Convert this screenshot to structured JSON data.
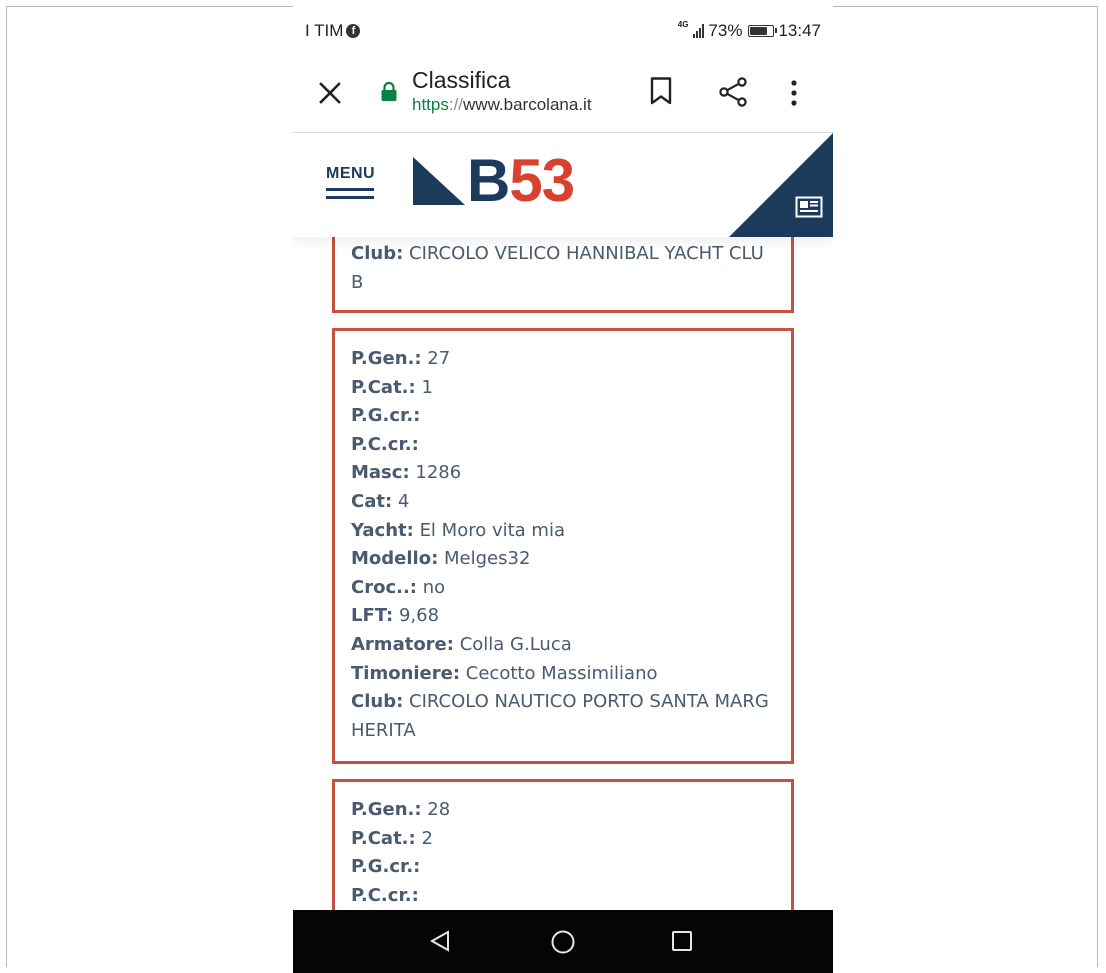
{
  "status_bar": {
    "carrier": "I TIM",
    "fb_glyph": "f",
    "network": "4G",
    "battery": "73%",
    "time": "13:47"
  },
  "browser": {
    "page_title": "Classifica",
    "url_scheme": "https",
    "url_sep": "://",
    "url_host": "www.barcolana.it"
  },
  "site": {
    "menu_label": "MENU",
    "logo_letter": "B",
    "logo_number": "53",
    "colors": {
      "navy": "#1b3a5c",
      "red": "#d7422e",
      "card_border": "#c7513f"
    }
  },
  "results": [
    {
      "rows": [
        {
          "k": "Club:",
          "v": "CIRCOLO VELICO HANNIBAL YACHT CLUB"
        }
      ]
    },
    {
      "rows": [
        {
          "k": "P.Gen.:",
          "v": "27"
        },
        {
          "k": "P.Cat.:",
          "v": "1"
        },
        {
          "k": "P.G.cr.:",
          "v": ""
        },
        {
          "k": "P.C.cr.:",
          "v": ""
        },
        {
          "k": "Masc:",
          "v": "1286"
        },
        {
          "k": "Cat:",
          "v": "4"
        },
        {
          "k": "Yacht:",
          "v": "El Moro vita mia"
        },
        {
          "k": "Modello:",
          "v": "Melges32"
        },
        {
          "k": "Croc..:",
          "v": "no"
        },
        {
          "k": "LFT:",
          "v": "9,68"
        },
        {
          "k": "Armatore:",
          "v": "Colla G.Luca"
        },
        {
          "k": "Timoniere:",
          "v": "Cecotto Massimiliano"
        },
        {
          "k": "Club:",
          "v": "CIRCOLO NAUTICO PORTO SANTA MARGHERITA"
        }
      ]
    },
    {
      "rows": [
        {
          "k": "P.Gen.:",
          "v": "28"
        },
        {
          "k": "P.Cat.:",
          "v": "2"
        },
        {
          "k": "P.G.cr.:",
          "v": ""
        },
        {
          "k": "P.C.cr.:",
          "v": ""
        }
      ]
    }
  ]
}
